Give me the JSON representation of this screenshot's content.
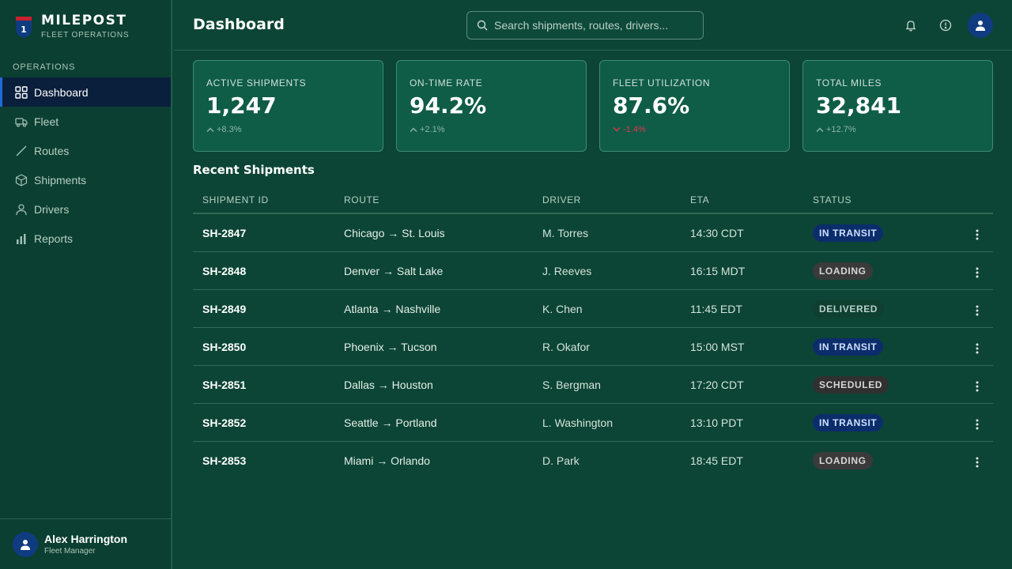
{
  "brand": {
    "name": "MILEPOST",
    "subtitle": "FLEET OPERATIONS",
    "shield_number": "1"
  },
  "sidebar": {
    "heading": "OPERATIONS",
    "items": [
      {
        "label": "Dashboard",
        "icon": "grid-icon",
        "active": true
      },
      {
        "label": "Fleet",
        "icon": "truck-icon",
        "active": false
      },
      {
        "label": "Routes",
        "icon": "route-icon",
        "active": false
      },
      {
        "label": "Shipments",
        "icon": "box-icon",
        "active": false
      },
      {
        "label": "Drivers",
        "icon": "person-icon",
        "active": false
      },
      {
        "label": "Reports",
        "icon": "bar-chart-icon",
        "active": false
      }
    ],
    "user": {
      "name": "Alex Harrington",
      "role": "Fleet Manager"
    }
  },
  "header": {
    "title": "Dashboard",
    "search_placeholder": "Search shipments, routes, drivers...",
    "search_value": ""
  },
  "stats": [
    {
      "label": "ACTIVE SHIPMENTS",
      "value": "1,247",
      "delta": "+8.3%",
      "trend": "up"
    },
    {
      "label": "ON-TIME RATE",
      "value": "94.2%",
      "delta": "+2.1%",
      "trend": "up"
    },
    {
      "label": "FLEET UTILIZATION",
      "value": "87.6%",
      "delta": "-1.4%",
      "trend": "down"
    },
    {
      "label": "TOTAL MILES",
      "value": "32,841",
      "delta": "+12.7%",
      "trend": "up"
    }
  ],
  "shipments": {
    "title": "Recent Shipments",
    "columns": [
      "SHIPMENT ID",
      "ROUTE",
      "DRIVER",
      "ETA",
      "STATUS"
    ],
    "rows": [
      {
        "id": "SH-2847",
        "route": "Chicago → St. Louis",
        "driver": "M. Torres",
        "eta": "14:30 CDT",
        "status": "IN TRANSIT",
        "status_type": "transit"
      },
      {
        "id": "SH-2848",
        "route": "Denver → Salt Lake",
        "driver": "J. Reeves",
        "eta": "16:15 MDT",
        "status": "LOADING",
        "status_type": "loading"
      },
      {
        "id": "SH-2849",
        "route": "Atlanta → Nashville",
        "driver": "K. Chen",
        "eta": "11:45 EDT",
        "status": "DELIVERED",
        "status_type": "delivered"
      },
      {
        "id": "SH-2850",
        "route": "Phoenix → Tucson",
        "driver": "R. Okafor",
        "eta": "15:00 MST",
        "status": "IN TRANSIT",
        "status_type": "transit"
      },
      {
        "id": "SH-2851",
        "route": "Dallas → Houston",
        "driver": "S. Bergman",
        "eta": "17:20 CDT",
        "status": "SCHEDULED",
        "status_type": "scheduled"
      },
      {
        "id": "SH-2852",
        "route": "Seattle → Portland",
        "driver": "L. Washington",
        "eta": "13:10 PDT",
        "status": "IN TRANSIT",
        "status_type": "transit"
      },
      {
        "id": "SH-2853",
        "route": "Miami → Orlando",
        "driver": "D. Park",
        "eta": "18:45 EDT",
        "status": "LOADING",
        "status_type": "loading"
      }
    ]
  },
  "colors": {
    "background": "#0c4535",
    "sidebar": "#0b3f31",
    "active_nav": "#0a1f3c",
    "card": "#0f5c47",
    "accent_blue": "#0f3b80",
    "negative": "#e0394a"
  }
}
